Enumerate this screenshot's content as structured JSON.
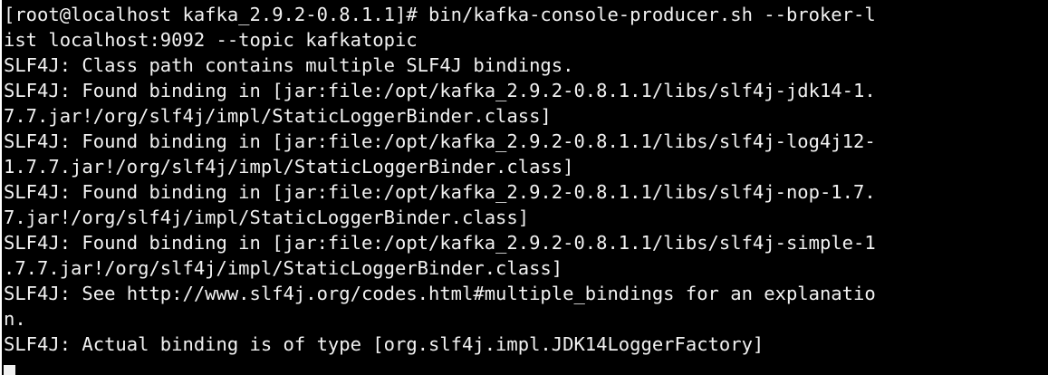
{
  "terminal": {
    "lines": [
      "[root@localhost kafka_2.9.2-0.8.1.1]# bin/kafka-console-producer.sh --broker-l",
      "ist localhost:9092 --topic kafkatopic",
      "SLF4J: Class path contains multiple SLF4J bindings.",
      "SLF4J: Found binding in [jar:file:/opt/kafka_2.9.2-0.8.1.1/libs/slf4j-jdk14-1.",
      "7.7.jar!/org/slf4j/impl/StaticLoggerBinder.class]",
      "SLF4J: Found binding in [jar:file:/opt/kafka_2.9.2-0.8.1.1/libs/slf4j-log4j12-",
      "1.7.7.jar!/org/slf4j/impl/StaticLoggerBinder.class]",
      "SLF4J: Found binding in [jar:file:/opt/kafka_2.9.2-0.8.1.1/libs/slf4j-nop-1.7.",
      "7.jar!/org/slf4j/impl/StaticLoggerBinder.class]",
      "SLF4J: Found binding in [jar:file:/opt/kafka_2.9.2-0.8.1.1/libs/slf4j-simple-1",
      ".7.7.jar!/org/slf4j/impl/StaticLoggerBinder.class]",
      "SLF4J: See http://www.slf4j.org/codes.html#multiple_bindings for an explanatio",
      "n.",
      "SLF4J: Actual binding is of type [org.slf4j.impl.JDK14LoggerFactory]"
    ],
    "colors": {
      "background": "#000000",
      "foreground": "#f2f2f2"
    }
  }
}
